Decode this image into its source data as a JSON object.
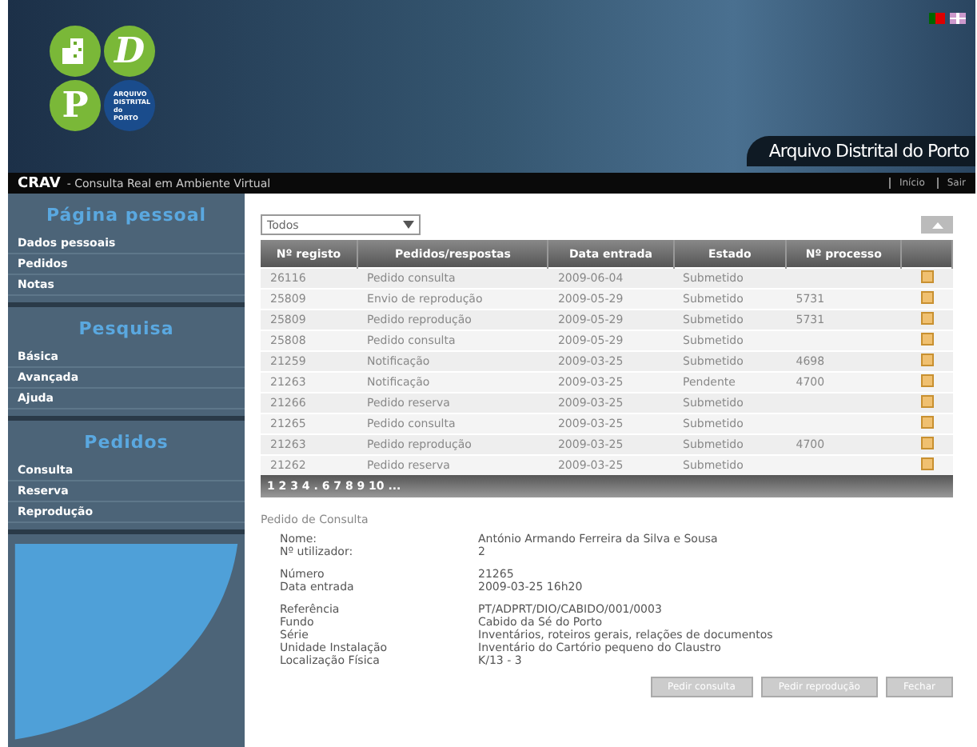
{
  "header": {
    "logo_letters": [
      "D",
      "P"
    ],
    "logo_text": "ARQUIVO DISTRITAL do PORTO",
    "site_title": "Arquivo Distrital do Porto"
  },
  "topbar": {
    "brand": "CRAV",
    "subtitle": "- Consulta Real em Ambiente Virtual",
    "links": [
      "Início",
      "Sair"
    ]
  },
  "sidebar": {
    "sections": [
      {
        "title": "Página pessoal",
        "items": [
          "Dados pessoais",
          "Pedidos",
          "Notas"
        ]
      },
      {
        "title": "Pesquisa",
        "items": [
          "Básica",
          "Avançada",
          "Ajuda"
        ]
      },
      {
        "title": "Pedidos",
        "items": [
          "Consulta",
          "Reserva",
          "Reprodução"
        ]
      }
    ]
  },
  "filter": {
    "value": "Todos"
  },
  "table": {
    "columns": [
      "Nº registo",
      "Pedidos/respostas",
      "Data entrada",
      "Estado",
      "Nº processo"
    ],
    "rows": [
      [
        "26116",
        "Pedido consulta",
        "2009-06-04",
        "Submetido",
        ""
      ],
      [
        "25809",
        "Envio de reprodução",
        "2009-05-29",
        "Submetido",
        "5731"
      ],
      [
        "25809",
        "Pedido reprodução",
        "2009-05-29",
        "Submetido",
        "5731"
      ],
      [
        "25808",
        "Pedido consulta",
        "2009-05-29",
        "Submetido",
        ""
      ],
      [
        "21259",
        "Notificação",
        "2009-03-25",
        "Submetido",
        "4698"
      ],
      [
        "21263",
        "Notificação",
        "2009-03-25",
        "Pendente",
        "4700"
      ],
      [
        "21266",
        "Pedido reserva",
        "2009-03-25",
        "Submetido",
        ""
      ],
      [
        "21265",
        "Pedido consulta",
        "2009-03-25",
        "Submetido",
        ""
      ],
      [
        "21263",
        "Pedido reprodução",
        "2009-03-25",
        "Submetido",
        "4700"
      ],
      [
        "21262",
        "Pedido reserva",
        "2009-03-25",
        "Submetido",
        ""
      ]
    ],
    "pagination": "1 2 3 4 . 6 7 8 9 10 ..."
  },
  "details": {
    "title": "Pedido de Consulta",
    "groups": [
      [
        {
          "label": "Nome:",
          "value": "António Armando Ferreira da Silva e Sousa"
        },
        {
          "label": "Nº utilizador:",
          "value": "2"
        }
      ],
      [
        {
          "label": "Número",
          "value": "21265"
        },
        {
          "label": "Data entrada",
          "value": "2009-03-25 16h20"
        }
      ],
      [
        {
          "label": "Referência",
          "value": "PT/ADPRT/DIO/CABIDO/001/0003"
        },
        {
          "label": "Fundo",
          "value": "Cabido da Sé do Porto"
        },
        {
          "label": "Série",
          "value": "Inventários, roteiros gerais, relações de documentos"
        },
        {
          "label": "Unidade Instalação",
          "value": "Inventário do Cartório pequeno do Claustro"
        },
        {
          "label": "Localização Física",
          "value": "K/13 - 3"
        }
      ]
    ]
  },
  "buttons": [
    "Pedir consulta",
    "Pedir reprodução",
    "Fechar"
  ]
}
